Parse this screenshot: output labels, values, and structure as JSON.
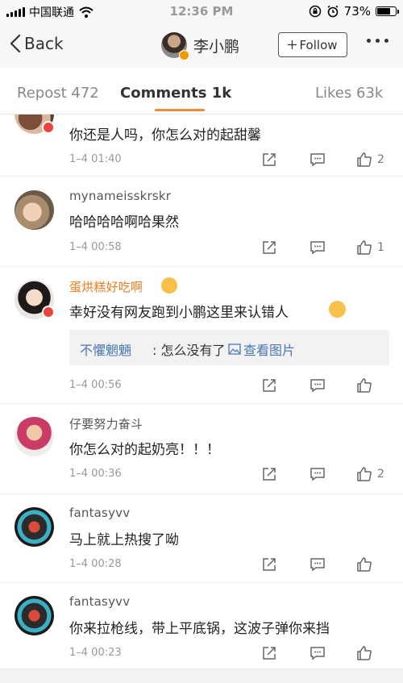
{
  "status_bar": {
    "carrier": "中国联通",
    "time": "12:36 PM",
    "battery": "73%",
    "battery_level": 0.73
  },
  "nav": {
    "back_label": "Back",
    "user_name": "李小鹏",
    "follow_label": "Follow"
  },
  "tabs": [
    {
      "label": "Repost 472"
    },
    {
      "label": "Comments 1k"
    },
    {
      "label": "Likes 63k"
    }
  ],
  "comments": [
    {
      "username": "",
      "text": "你还是人吗，你怎么对的起甜馨",
      "time": "1–4 01:40",
      "likes": "2"
    },
    {
      "username": "mynameisskrskr",
      "text": "哈哈哈哈啊哈果然",
      "time": "1–4 00:58",
      "likes": "1"
    },
    {
      "username": "蛋烘糕好吃啊",
      "text": "幸好没有网友跑到小鹏这里来认错人",
      "time": "1–4 00:56",
      "likes": "",
      "reply": {
        "name": "不懼魍魎",
        "text": ": 怎么没有了",
        "link": "查看图片"
      }
    },
    {
      "username": "仔要努力奋斗",
      "text": "你怎么对的起奶亮！！！",
      "time": "1–4 00:36",
      "likes": "2"
    },
    {
      "username": "fantasyvv",
      "text": "马上就上热搜了呦",
      "time": "1–4 00:28",
      "likes": ""
    },
    {
      "username": "fantasyvv",
      "text": "你来拉枪线，带上平底锅，这波子弹你来挡",
      "time": "1–4 00:23",
      "likes": ""
    }
  ],
  "colors": {
    "accent": "#f18a3a",
    "link": "#4a78b0",
    "vip_name": "#f07c1a"
  }
}
